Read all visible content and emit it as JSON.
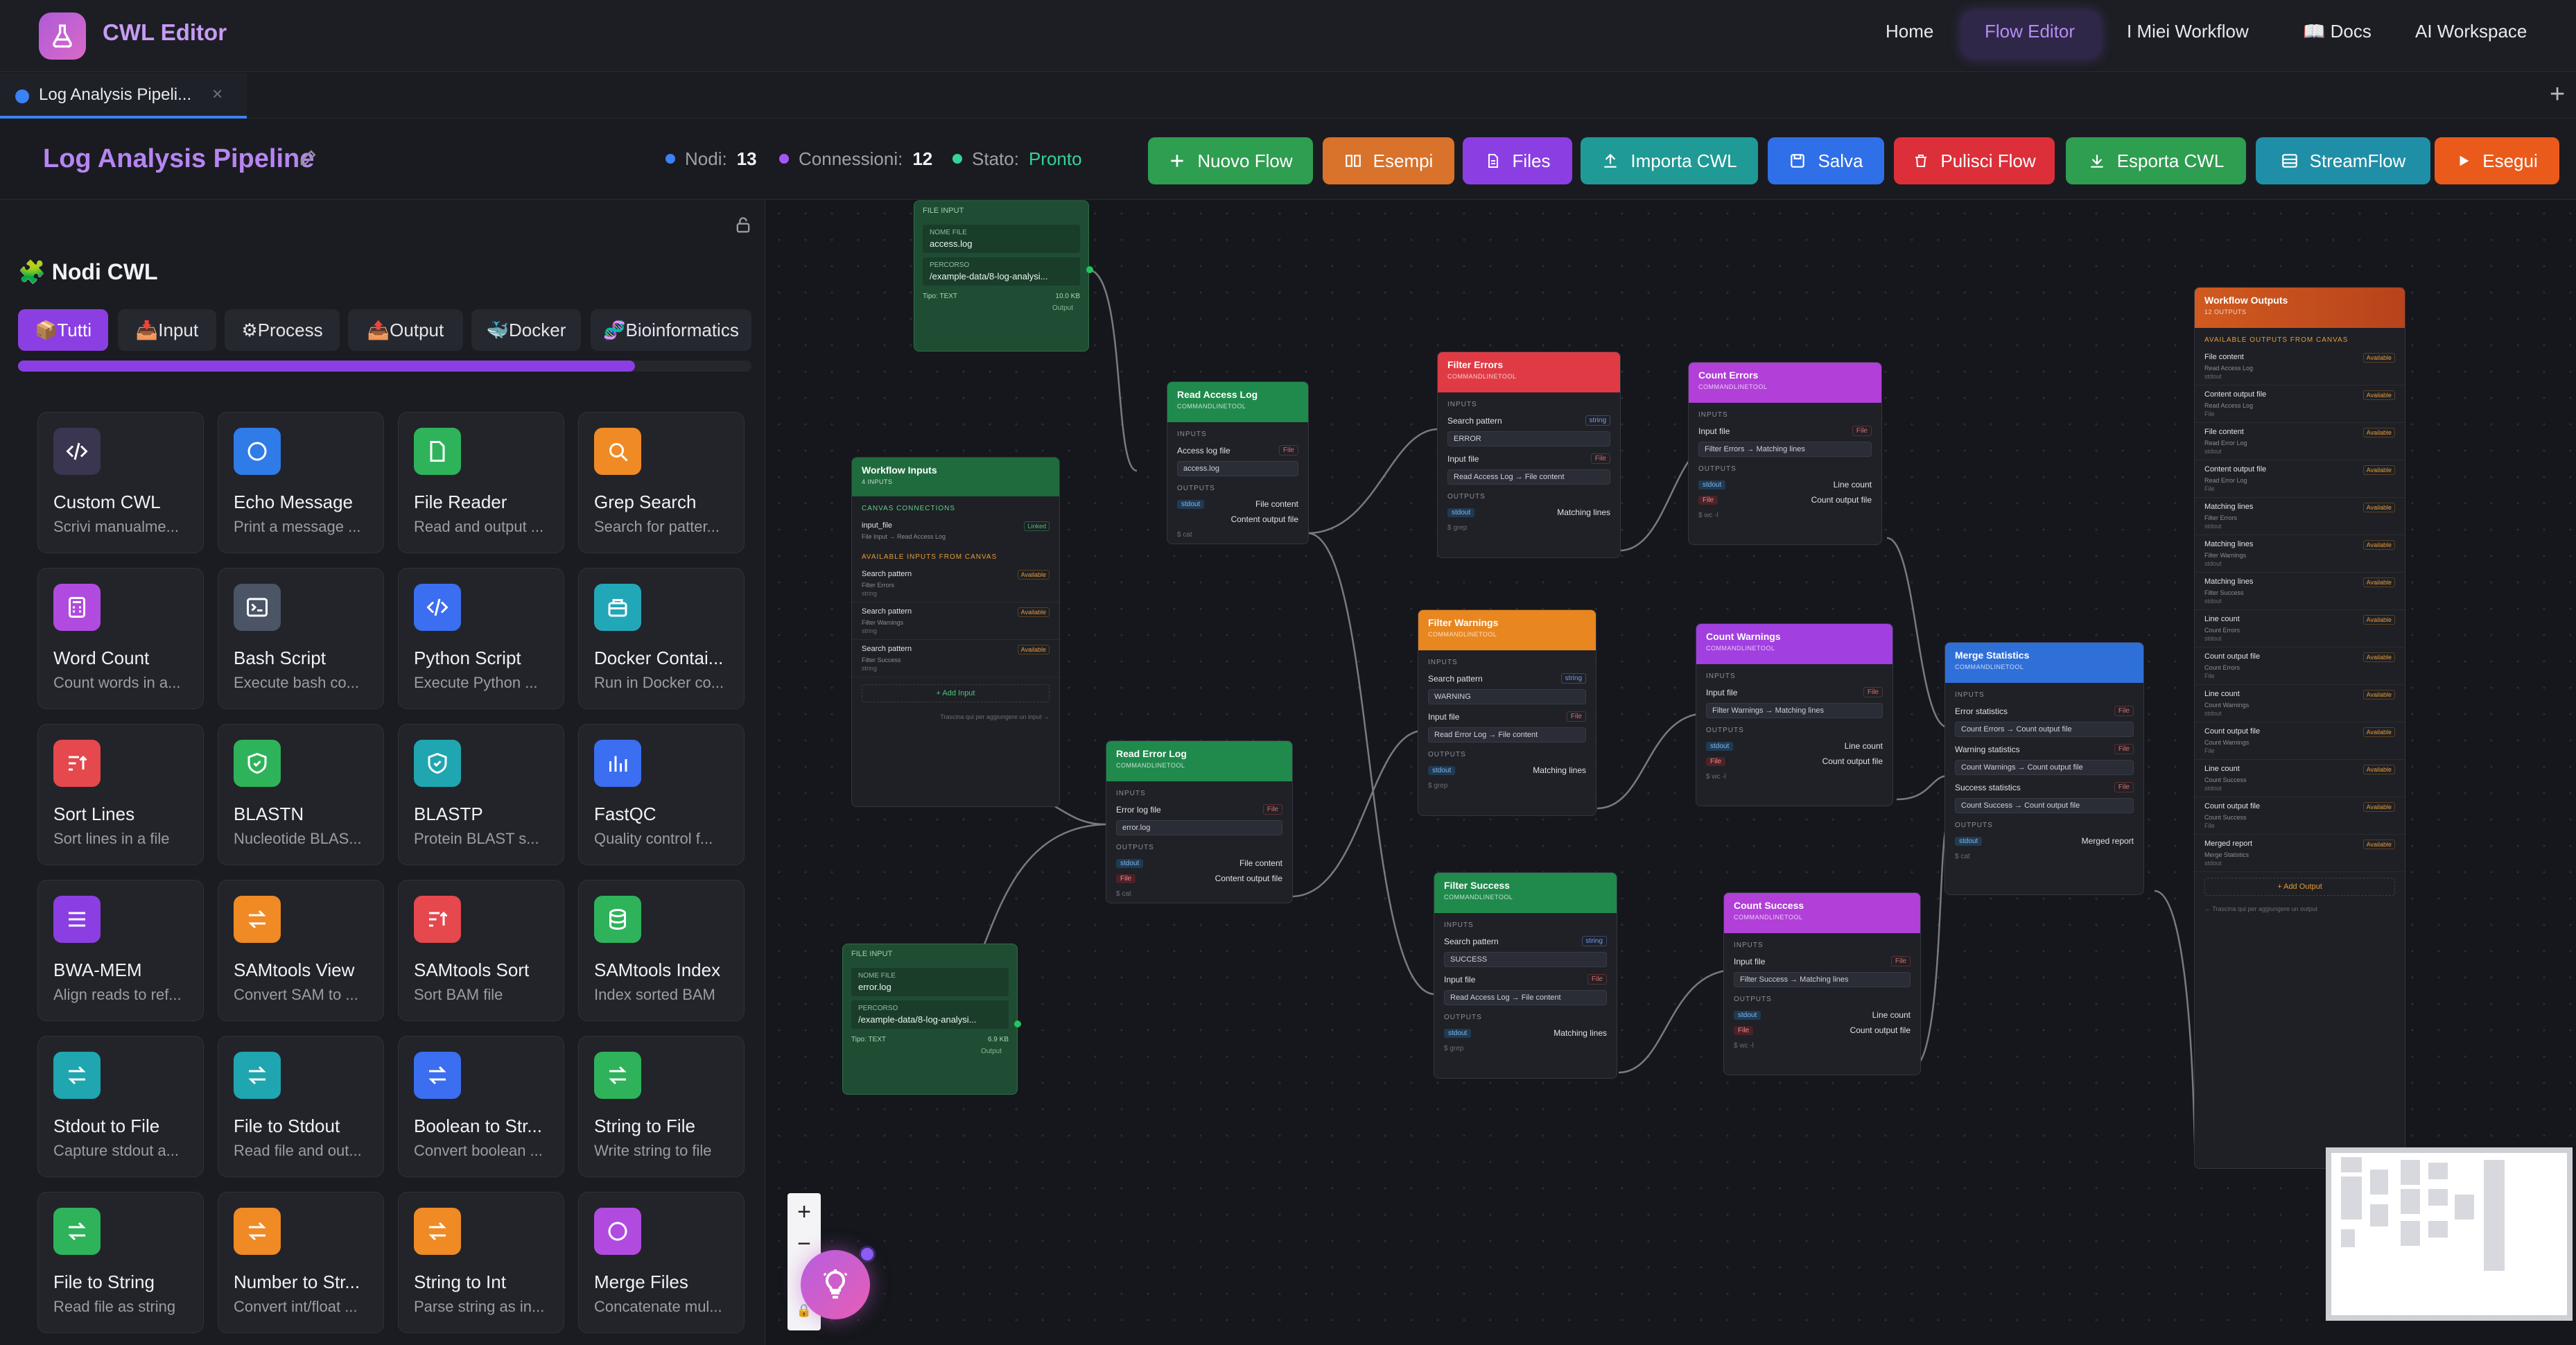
{
  "app": {
    "title": "CWL Editor"
  },
  "nav": {
    "links": [
      "Home",
      "Flow Editor",
      "I Miei Workflow",
      "Docs",
      "AI Workspace"
    ],
    "active": "Flow Editor"
  },
  "tab": {
    "label": "Log Analysis Pipeli...",
    "close": "×",
    "add": "+"
  },
  "pipeline": {
    "title": "Log Analysis Pipeline",
    "stats": {
      "nodes_label": "Nodi:",
      "nodes": "13",
      "connections_label": "Connessioni:",
      "connections": "12",
      "state_label": "Stato:",
      "state": "Pronto"
    },
    "buttons": [
      {
        "label": "Nuovo Flow",
        "color": "#2e9e50",
        "icon": "plus-icon"
      },
      {
        "label": "Esempi",
        "color": "#d9722a",
        "icon": "book-icon"
      },
      {
        "label": "Files",
        "color": "#8b3fe3",
        "icon": "file-icon"
      },
      {
        "label": "Importa CWL",
        "color": "#1f9a96",
        "icon": "upload-icon"
      },
      {
        "label": "Salva",
        "color": "#2f6fe8",
        "icon": "save-icon"
      },
      {
        "label": "Pulisci Flow",
        "color": "#dc2f3a",
        "icon": "trash-icon"
      },
      {
        "label": "Esporta CWL",
        "color": "#2e9e50",
        "icon": "download-icon"
      },
      {
        "label": "StreamFlow",
        "color": "#1f8fa8",
        "icon": "stream-icon"
      },
      {
        "label": "Esegui",
        "color": "#ea5a1a",
        "icon": "play-icon"
      }
    ]
  },
  "sidebar": {
    "title": "Nodi CWL",
    "chips": [
      "Tutti",
      "Input",
      "Process",
      "Output",
      "Docker",
      "Bioinformatics"
    ],
    "cards": [
      {
        "name": "Custom CWL",
        "desc": "Scrivi manualme...",
        "color": "#3a3550",
        "icon": "code-icon"
      },
      {
        "name": "Echo Message",
        "desc": "Print a message ...",
        "color": "#2f7be8",
        "icon": "chat-icon"
      },
      {
        "name": "File Reader",
        "desc": "Read and output ...",
        "color": "#2eb35a",
        "icon": "file-icon"
      },
      {
        "name": "Grep Search",
        "desc": "Search for patter...",
        "color": "#f08a24",
        "icon": "search-icon"
      },
      {
        "name": "Word Count",
        "desc": "Count words in a...",
        "color": "#b14be0",
        "icon": "calculator-icon"
      },
      {
        "name": "Bash Script",
        "desc": "Execute bash co...",
        "color": "#4b5566",
        "icon": "terminal-icon"
      },
      {
        "name": "Python Script",
        "desc": "Execute Python ...",
        "color": "#3b6ef0",
        "icon": "code-icon"
      },
      {
        "name": "Docker Contai...",
        "desc": "Run in Docker co...",
        "color": "#22a7b8",
        "icon": "container-icon"
      },
      {
        "name": "Sort Lines",
        "desc": "Sort lines in a file",
        "color": "#e5484d",
        "icon": "sort-icon"
      },
      {
        "name": "BLASTN",
        "desc": "Nucleotide BLAS...",
        "color": "#2eb35a",
        "icon": "shield-icon"
      },
      {
        "name": "BLASTP",
        "desc": "Protein BLAST s...",
        "color": "#1fa6b0",
        "icon": "shield-icon"
      },
      {
        "name": "FastQC",
        "desc": "Quality control f...",
        "color": "#3b6ef0",
        "icon": "chart-icon"
      },
      {
        "name": "BWA-MEM",
        "desc": "Align reads to ref...",
        "color": "#8b3fe3",
        "icon": "menu-icon"
      },
      {
        "name": "SAMtools View",
        "desc": "Convert SAM to ...",
        "color": "#f08a24",
        "icon": "swap-icon"
      },
      {
        "name": "SAMtools Sort",
        "desc": "Sort BAM file",
        "color": "#e5484d",
        "icon": "sort-icon"
      },
      {
        "name": "SAMtools Index",
        "desc": "Index sorted BAM",
        "color": "#2eb35a",
        "icon": "database-icon"
      },
      {
        "name": "Stdout to File",
        "desc": "Capture stdout a...",
        "color": "#1fa6b0",
        "icon": "swap-icon"
      },
      {
        "name": "File to Stdout",
        "desc": "Read file and out...",
        "color": "#1fa6b0",
        "icon": "swap-icon"
      },
      {
        "name": "Boolean to Str...",
        "desc": "Convert boolean ...",
        "color": "#3b6ef0",
        "icon": "swap-icon"
      },
      {
        "name": "String to File",
        "desc": "Write string to file",
        "color": "#2eb35a",
        "icon": "swap-icon"
      },
      {
        "name": "File to String",
        "desc": "Read file as string",
        "color": "#2eb35a",
        "icon": "swap-icon"
      },
      {
        "name": "Number to Str...",
        "desc": "Convert int/float ...",
        "color": "#f08a24",
        "icon": "swap-icon"
      },
      {
        "name": "String to Int",
        "desc": "Parse string as in...",
        "color": "#f08a24",
        "icon": "swap-icon"
      },
      {
        "name": "Merge Files",
        "desc": "Concatenate mul...",
        "color": "#b14be0",
        "icon": "chat-icon"
      }
    ]
  },
  "canvas": {
    "file_access": {
      "tag": "FILE INPUT",
      "name_label": "NOME FILE",
      "name": "access.log",
      "path_label": "PERCORSO",
      "path": "/example-data/8-log-analysi...",
      "type": "Tipo: TEXT",
      "size": "10.0 KB",
      "output": "Output"
    },
    "file_error": {
      "tag": "FILE INPUT",
      "name_label": "NOME FILE",
      "name": "error.log",
      "path_label": "PERCORSO",
      "path": "/example-data/8-log-analysi...",
      "type": "Tipo: TEXT",
      "size": "6.9 KB",
      "output": "Output"
    },
    "workflow_inputs": {
      "title": "Workflow Inputs",
      "subtitle": "4 INPUTS",
      "conn_label": "CANVAS CONNECTIONS",
      "conn_name": "input_file",
      "conn_sub": "File Input → Read Access Log",
      "conn_badge": "Linked",
      "avail_label": "AVAILABLE INPUTS FROM CANVAS",
      "items": [
        {
          "name": "Search pattern",
          "sub": "Filter Errors",
          "type": "string",
          "badge": "Available"
        },
        {
          "name": "Search pattern",
          "sub": "Filter Warnings",
          "type": "string",
          "badge": "Available"
        },
        {
          "name": "Search pattern",
          "sub": "Filter Success",
          "type": "string",
          "badge": "Available"
        }
      ],
      "add": "+ Add Input",
      "hint": "Trascina qui per aggiungere un input →"
    },
    "tools": {
      "read_access": {
        "title": "Read Access Log",
        "sub": "COMMANDLINETOOL",
        "inputs": "INPUTS",
        "in_label": "Access log file",
        "in_value": "access.log",
        "outputs": "OUTPUTS",
        "out1": "File content",
        "out2": "Content output file",
        "foot": "$ cat"
      },
      "read_error": {
        "title": "Read Error Log",
        "sub": "COMMANDLINETOOL",
        "inputs": "INPUTS",
        "in_label": "Error log file",
        "in_value": "error.log",
        "outputs": "OUTPUTS",
        "out1": "File content",
        "out2": "Content output file",
        "foot": "$ cat"
      },
      "filter_errors": {
        "title": "Filter Errors",
        "sub": "COMMANDLINETOOL",
        "inputs": "INPUTS",
        "p_label": "Search pattern",
        "p_value": "ERROR",
        "f_label": "Input file",
        "f_value": "Read Access Log → File content",
        "outputs": "OUTPUTS",
        "out1": "Matching lines",
        "foot": "$ grep"
      },
      "filter_warnings": {
        "title": "Filter Warnings",
        "sub": "COMMANDLINETOOL",
        "inputs": "INPUTS",
        "p_label": "Search pattern",
        "p_value": "WARNING",
        "f_label": "Input file",
        "f_value": "Read Error Log → File content",
        "outputs": "OUTPUTS",
        "out1": "Matching lines",
        "foot": "$ grep"
      },
      "filter_success": {
        "title": "Filter Success",
        "sub": "COMMANDLINETOOL",
        "inputs": "INPUTS",
        "p_label": "Search pattern",
        "p_value": "SUCCESS",
        "f_label": "Input file",
        "f_value": "Read Access Log → File content",
        "outputs": "OUTPUTS",
        "out1": "Matching lines",
        "foot": "$ grep"
      },
      "count_errors": {
        "title": "Count Errors",
        "sub": "COMMANDLINETOOL",
        "inputs": "INPUTS",
        "f_label": "Input file",
        "f_value": "Filter Errors → Matching lines",
        "outputs": "OUTPUTS",
        "out1": "Line count",
        "out2": "Count output file",
        "foot": "$ wc -l"
      },
      "count_warnings": {
        "title": "Count Warnings",
        "sub": "COMMANDLINETOOL",
        "inputs": "INPUTS",
        "f_label": "Input file",
        "f_value": "Filter Warnings → Matching lines",
        "outputs": "OUTPUTS",
        "out1": "Line count",
        "out2": "Count output file",
        "foot": "$ wc -l"
      },
      "count_success": {
        "title": "Count Success",
        "sub": "COMMANDLINETOOL",
        "inputs": "INPUTS",
        "f_label": "Input file",
        "f_value": "Filter Success → Matching lines",
        "outputs": "OUTPUTS",
        "out1": "Line count",
        "out2": "Count output file",
        "foot": "$ wc -l"
      },
      "merge": {
        "title": "Merge Statistics",
        "sub": "COMMANDLINETOOL",
        "inputs": "INPUTS",
        "i1": "Error statistics",
        "v1": "Count Errors → Count output file",
        "i2": "Warning statistics",
        "v2": "Count Warnings → Count output file",
        "i3": "Success statistics",
        "v3": "Count Success → Count output file",
        "outputs": "OUTPUTS",
        "out1": "Merged report",
        "foot": "$ cat"
      }
    },
    "workflow_outputs": {
      "title": "Workflow Outputs",
      "subtitle": "12 OUTPUTS",
      "avail_label": "AVAILABLE OUTPUTS FROM CANVAS",
      "items": [
        {
          "name": "File content",
          "sub": "Read Access Log",
          "type": "stdout"
        },
        {
          "name": "Content output file",
          "sub": "Read Access Log",
          "type": "File"
        },
        {
          "name": "File content",
          "sub": "Read Error Log",
          "type": "stdout"
        },
        {
          "name": "Content output file",
          "sub": "Read Error Log",
          "type": "File"
        },
        {
          "name": "Matching lines",
          "sub": "Filter Errors",
          "type": "stdout"
        },
        {
          "name": "Matching lines",
          "sub": "Filter Warnings",
          "type": "stdout"
        },
        {
          "name": "Matching lines",
          "sub": "Filter Success",
          "type": "stdout"
        },
        {
          "name": "Line count",
          "sub": "Count Errors",
          "type": "stdout"
        },
        {
          "name": "Count output file",
          "sub": "Count Errors",
          "type": "File"
        },
        {
          "name": "Line count",
          "sub": "Count Warnings",
          "type": "stdout"
        },
        {
          "name": "Count output file",
          "sub": "Count Warnings",
          "type": "File"
        },
        {
          "name": "Line count",
          "sub": "Count Success",
          "type": "stdout"
        },
        {
          "name": "Count output file",
          "sub": "Count Success",
          "type": "File"
        },
        {
          "name": "Merged report",
          "sub": "Merge Statistics",
          "type": "stdout"
        }
      ],
      "badge": "Available",
      "add": "+ Add Output",
      "hint": "← Trascina qui per aggiungere un output"
    },
    "type_labels": {
      "string": "string",
      "file": "File",
      "stdout": "stdout"
    },
    "zoom": {
      "in": "+",
      "out": "−"
    }
  }
}
